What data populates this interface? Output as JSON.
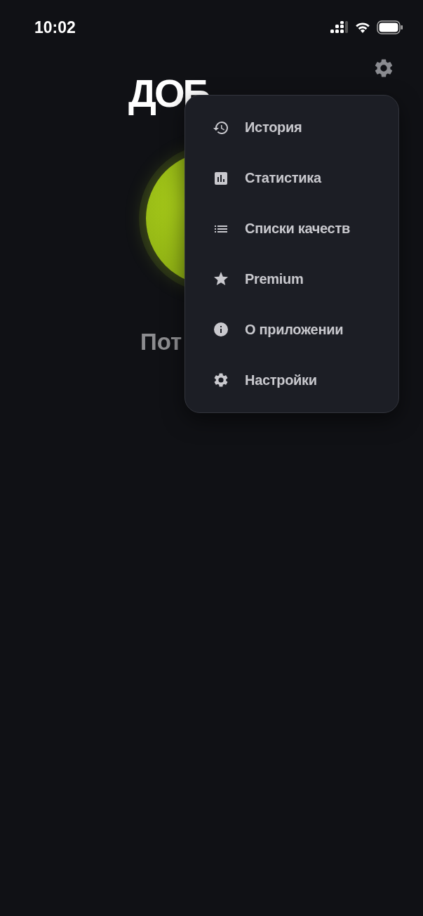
{
  "status_bar": {
    "time": "10:02"
  },
  "title": "ДОБ",
  "subtitle": "Пот",
  "menu": {
    "items": [
      {
        "kind": "history",
        "label": "История"
      },
      {
        "kind": "stats",
        "label": "Статистика"
      },
      {
        "kind": "list",
        "label": "Списки качеств"
      },
      {
        "kind": "star",
        "label": "Premium"
      },
      {
        "kind": "info",
        "label": "О приложении"
      },
      {
        "kind": "gear",
        "label": "Настройки"
      }
    ]
  }
}
